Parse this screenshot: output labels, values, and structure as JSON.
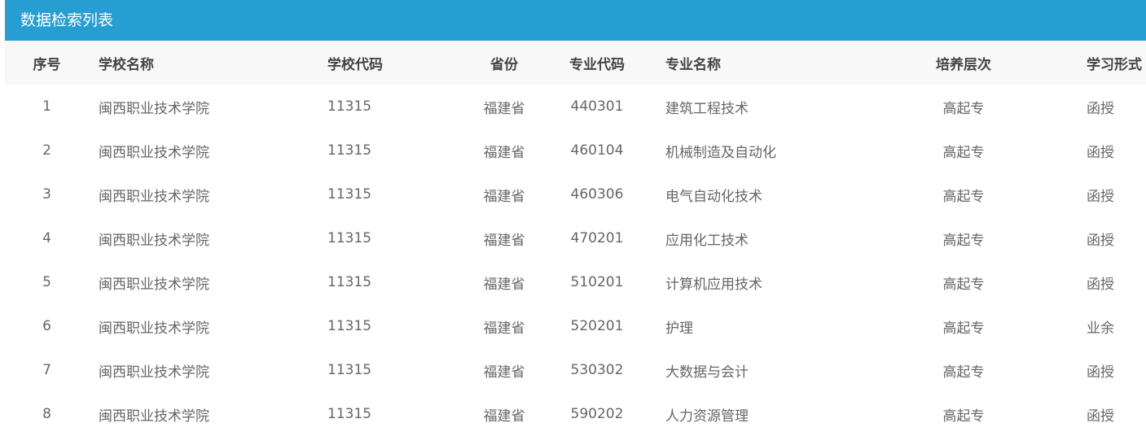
{
  "panel": {
    "title": "数据检索列表"
  },
  "colors": {
    "header_bg": "#279ed1",
    "thead_bg": "#f8f8f8"
  },
  "table": {
    "headers": [
      "序号",
      "学校名称",
      "学校代码",
      "省份",
      "专业代码",
      "专业名称",
      "培养层次",
      "学习形式"
    ],
    "rows": [
      [
        "1",
        "闽西职业技术学院",
        "11315",
        "福建省",
        "440301",
        "建筑工程技术",
        "高起专",
        "函授"
      ],
      [
        "2",
        "闽西职业技术学院",
        "11315",
        "福建省",
        "460104",
        "机械制造及自动化",
        "高起专",
        "函授"
      ],
      [
        "3",
        "闽西职业技术学院",
        "11315",
        "福建省",
        "460306",
        "电气自动化技术",
        "高起专",
        "函授"
      ],
      [
        "4",
        "闽西职业技术学院",
        "11315",
        "福建省",
        "470201",
        "应用化工技术",
        "高起专",
        "函授"
      ],
      [
        "5",
        "闽西职业技术学院",
        "11315",
        "福建省",
        "510201",
        "计算机应用技术",
        "高起专",
        "函授"
      ],
      [
        "6",
        "闽西职业技术学院",
        "11315",
        "福建省",
        "520201",
        "护理",
        "高起专",
        "业余"
      ],
      [
        "7",
        "闽西职业技术学院",
        "11315",
        "福建省",
        "530302",
        "大数据与会计",
        "高起专",
        "函授"
      ],
      [
        "8",
        "闽西职业技术学院",
        "11315",
        "福建省",
        "590202",
        "人力资源管理",
        "高起专",
        "函授"
      ]
    ]
  }
}
